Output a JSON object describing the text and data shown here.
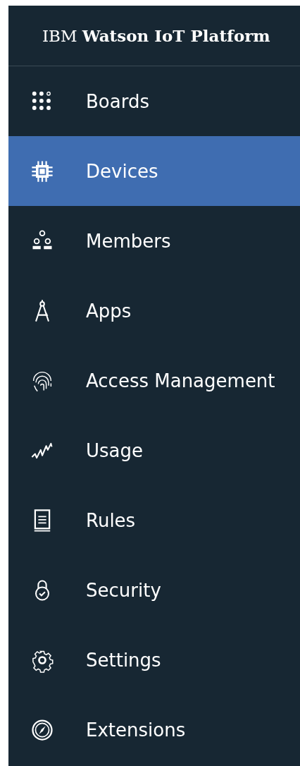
{
  "header": {
    "title": "IBM **Watson IoT Platform**"
  },
  "nav": [
    {
      "label": "Boards",
      "selected": false
    },
    {
      "label": "Devices",
      "selected": true
    },
    {
      "label": "Members",
      "selected": false
    },
    {
      "label": "Apps",
      "selected": false
    },
    {
      "label": "Access Management",
      "selected": false
    },
    {
      "label": "Usage",
      "selected": false
    },
    {
      "label": "Rules",
      "selected": false
    },
    {
      "label": "Security",
      "selected": false
    },
    {
      "label": "Settings",
      "selected": false
    },
    {
      "label": "Extensions",
      "selected": false
    }
  ]
}
